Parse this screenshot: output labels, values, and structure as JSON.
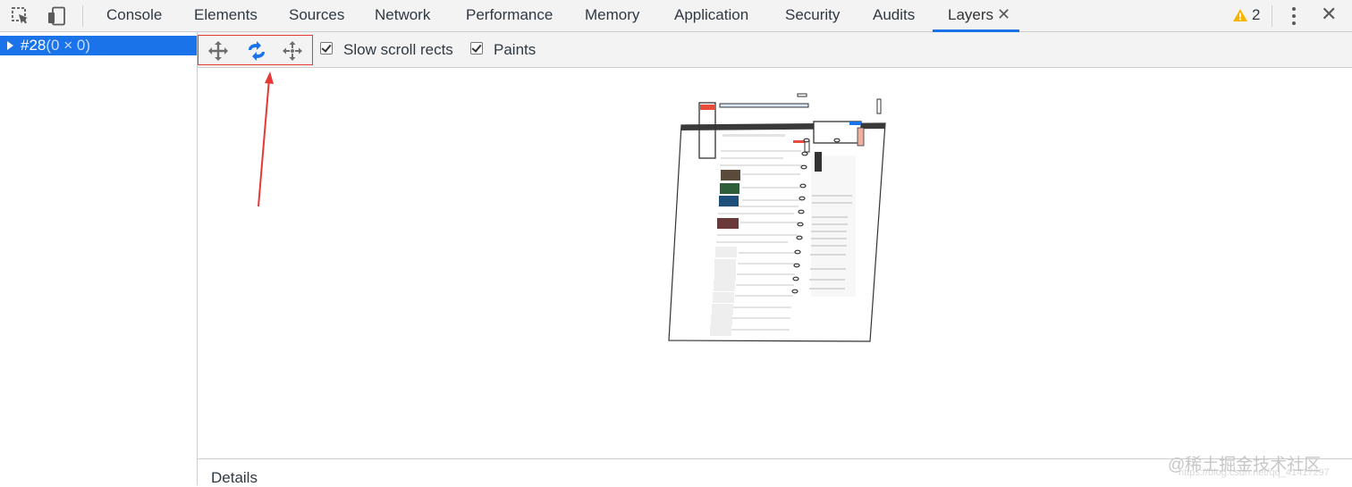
{
  "toolbar": {
    "icons": [
      "inspect-element-icon",
      "device-toolbar-icon"
    ]
  },
  "tabs": [
    {
      "label": "Console"
    },
    {
      "label": "Elements"
    },
    {
      "label": "Sources"
    },
    {
      "label": "Network"
    },
    {
      "label": "Performance"
    },
    {
      "label": "Memory"
    },
    {
      "label": "Application"
    },
    {
      "label": "Security"
    },
    {
      "label": "Audits"
    },
    {
      "label": "Layers",
      "active": true,
      "closable": true
    }
  ],
  "status": {
    "warning_count": "2",
    "warning_icon": "warning-triangle-icon"
  },
  "layers_tree": {
    "selected": {
      "id": "#28",
      "size": "(0 × 0)"
    }
  },
  "layers_toolbar": {
    "modes": [
      "pan-mode",
      "rotate-mode",
      "reset-transform"
    ],
    "checkboxes": [
      {
        "label": "Slow scroll rects",
        "checked": true
      },
      {
        "label": "Paints",
        "checked": true
      }
    ]
  },
  "details": {
    "label": "Details"
  },
  "watermark": {
    "text": "@稀土掘金技术社区",
    "url": "https://blog.csdn.net/qq_41417297"
  },
  "colors": {
    "accent": "#1a73e8",
    "annotation": "#e53935",
    "warning": "#f4b400"
  }
}
